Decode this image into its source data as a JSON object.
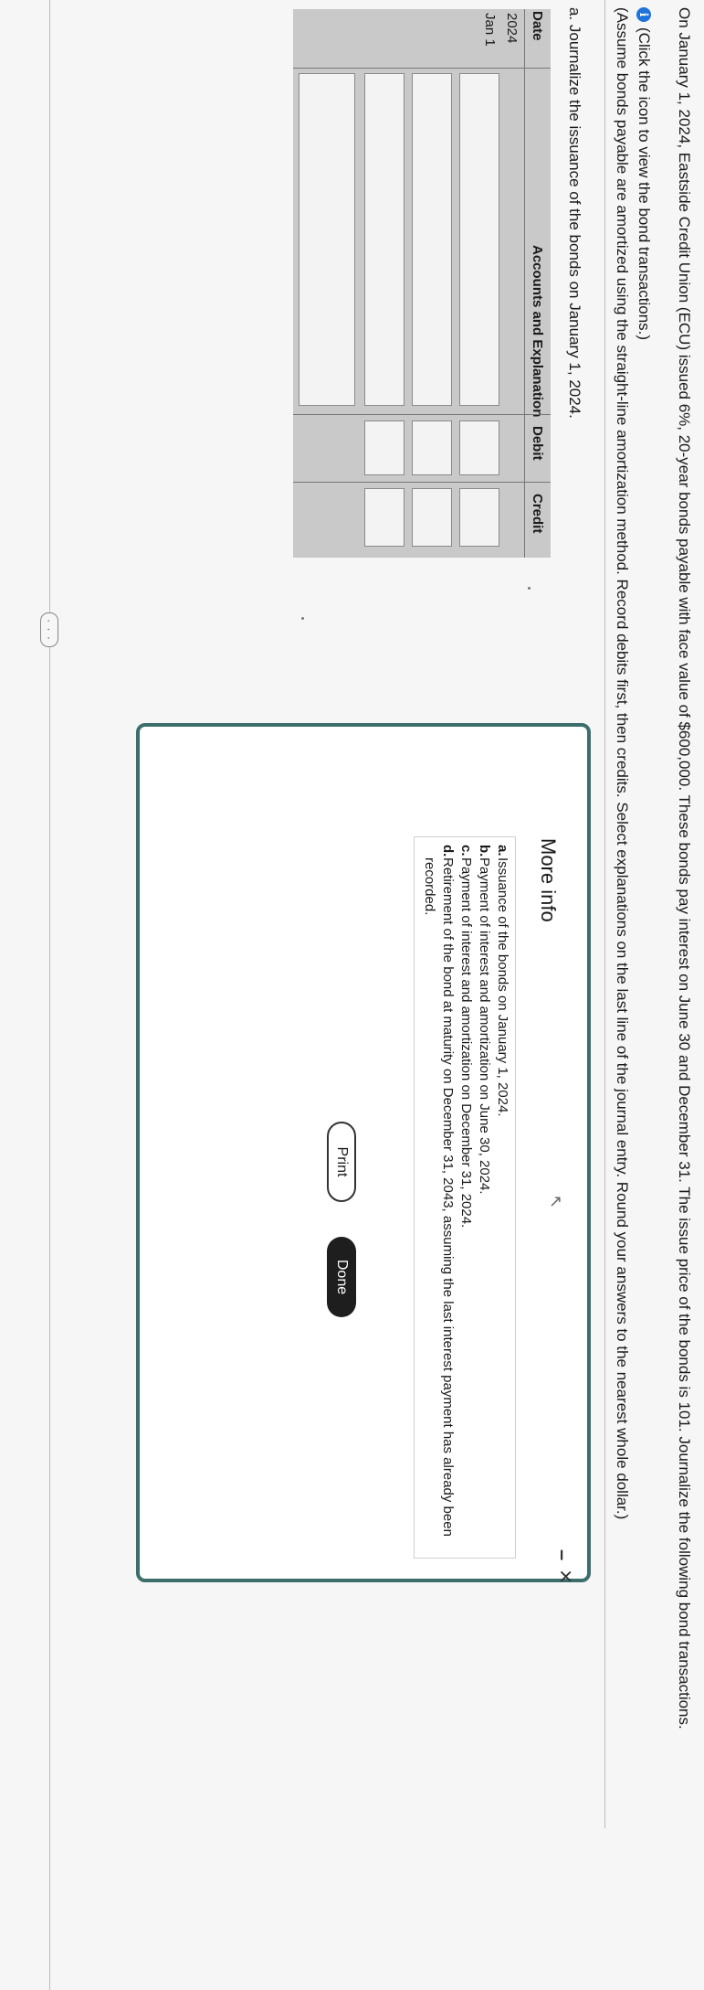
{
  "problem": {
    "statement": "On January 1, 2024, Eastside Credit Union (ECU) issued 6%, 20-year bonds payable with face value of $600,000. These bonds pay interest on June 30 and December 31. The issue price of the bonds is 101. Journalize the following bond transactions.",
    "info_link": "(Click the icon to view the bond transactions.)",
    "assumption": "(Assume bonds payable are amortized using the straight-line amortization method. Record debits first, then credits. Select explanations on the last line of the journal entry. Round your answers to the nearest whole dollar.)"
  },
  "part_a": {
    "prompt": "a. Journalize the issuance of the bonds on January 1, 2024."
  },
  "journal": {
    "headers": {
      "date": "Date",
      "accounts": "Accounts and Explanation",
      "debit": "Debit",
      "credit": "Credit"
    },
    "year": "2024",
    "date": "Jan 1"
  },
  "ellipsis": "· · ·",
  "modal": {
    "title": "More info",
    "minimize": "–",
    "close": "×",
    "items": [
      {
        "letter": "a.",
        "text": "Issuance of the bonds on January 1, 2024."
      },
      {
        "letter": "b.",
        "text": "Payment of interest and amortization on June 30, 2024."
      },
      {
        "letter": "c.",
        "text": "Payment of interest and amortization on December 31, 2024."
      },
      {
        "letter": "d.",
        "text": "Retirement of the bond at maturity on December 31, 2043, assuming the last interest payment has already been recorded."
      }
    ],
    "print_label": "Print",
    "done_label": "Done"
  }
}
